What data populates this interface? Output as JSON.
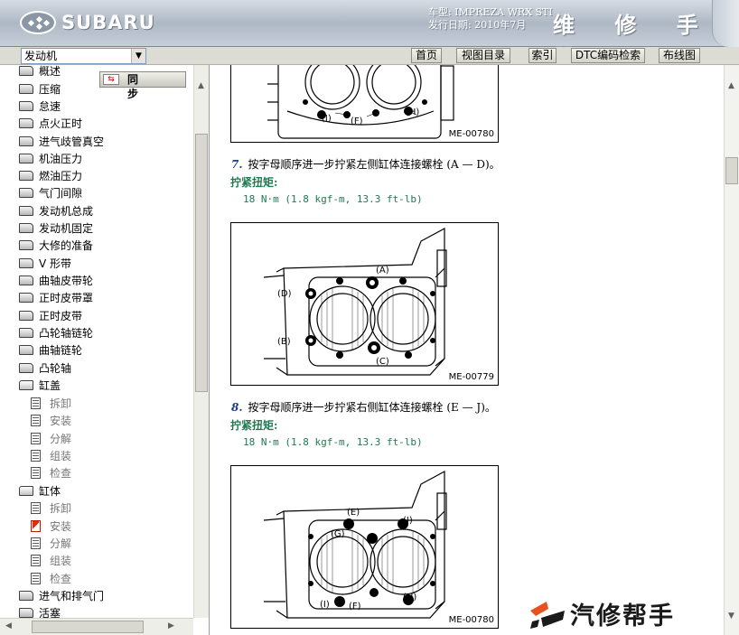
{
  "header": {
    "brand": "SUBARU",
    "vehicle_line": "车型: IMPREZA WRX STI",
    "release_line": "发行日期: 2010年7月",
    "manual_title": "维 修 手 册"
  },
  "toolbar": {
    "section_value": "发动机",
    "buttons": [
      "首页",
      "视图目录",
      "索引",
      "DTC编码检索",
      "布线图"
    ]
  },
  "sidebar": {
    "sync_label": "同 步",
    "items": [
      "概述",
      "压缩",
      "怠速",
      "点火正时",
      "进气歧管真空",
      "机油压力",
      "燃油压力",
      "气门间隙",
      "发动机总成",
      "发动机固定",
      "大修的准备",
      "V 形带",
      "曲轴皮带轮",
      "正时皮带罩",
      "正时皮带",
      "凸轮轴链轮",
      "曲轴链轮",
      "凸轮轴",
      "缸盖",
      "拆卸",
      "安装",
      "分解",
      "组装",
      "检查",
      "缸体",
      "拆卸",
      "安装",
      "分解",
      "组装",
      "检查",
      "进气和排气门",
      "活塞"
    ]
  },
  "content": {
    "figure1": {
      "caption": "ME-00780",
      "labels": [
        "(I)",
        "(F)",
        "(H)"
      ]
    },
    "step7": {
      "num": "7.",
      "text": "按字母顺序进一步拧紧左侧缸体连接螺栓 (A — D)。"
    },
    "torque_title_1": "拧紧扭矩:",
    "torque_value_1": "18 N·m (1.8 kgf-m, 13.3 ft-lb)",
    "figure2": {
      "caption": "ME-00779",
      "labels": [
        "(A)",
        "(D)",
        "(B)",
        "(C)"
      ]
    },
    "step8": {
      "num": "8.",
      "text": "按字母顺序进一步拧紧右侧缸体连接螺栓 (E — J)。"
    },
    "torque_title_2": "拧紧扭矩:",
    "torque_value_2": "18 N·m (1.8 kgf-m, 13.3 ft-lb)",
    "figure3": {
      "caption": "ME-00780",
      "labels": [
        "(E)",
        "(J)",
        "(G)",
        "(I)",
        "(F)",
        "(H)"
      ]
    }
  },
  "watermark": {
    "text": "汽修帮手"
  }
}
